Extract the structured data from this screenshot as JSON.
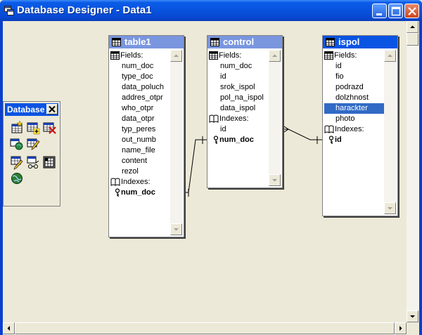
{
  "window": {
    "title": "Database Designer - Data1",
    "buttons": [
      "minimize",
      "maximize",
      "close"
    ]
  },
  "toolbar": {
    "title": "Database",
    "close_glyph": "✕",
    "tools": [
      "new-table-icon",
      "add-table-icon",
      "remove-table-icon",
      "add-view-icon",
      "modify-table-icon",
      "edit-stored-procedures-icon",
      "connections-icon",
      "browse-table-icon",
      "remote-view-icon"
    ]
  },
  "tables": [
    {
      "name": "table1",
      "active": false,
      "fields_label": "Fields:",
      "fields": [
        "num_doc",
        "type_doc",
        "data_poluch",
        "addres_otpr",
        "who_otpr",
        "data_otpr",
        "typ_peres",
        "out_numb",
        "name_file",
        "content",
        "rezol"
      ],
      "indexes_label": "Indexes:",
      "indexes": [
        "num_doc"
      ],
      "selected": null
    },
    {
      "name": "control",
      "active": false,
      "fields_label": "Fields:",
      "fields": [
        "num_doc",
        "id",
        "srok_ispol",
        "pol_na_ispol",
        "data_ispol"
      ],
      "indexes_label": "Indexes:",
      "indexes_plain": [
        "id"
      ],
      "indexes": [
        "num_doc"
      ],
      "selected": null
    },
    {
      "name": "ispol",
      "active": true,
      "fields_label": "Fields:",
      "fields": [
        "id",
        "fio",
        "podrazd",
        "dolzhnost",
        "harackter",
        "photo"
      ],
      "indexes_label": "Indexes:",
      "indexes": [
        "id"
      ],
      "selected": "harackter"
    }
  ],
  "relations": [
    {
      "from": "table1.num_doc",
      "to": "control.num_doc"
    },
    {
      "from": "control.id",
      "to": "ispol.id"
    }
  ]
}
